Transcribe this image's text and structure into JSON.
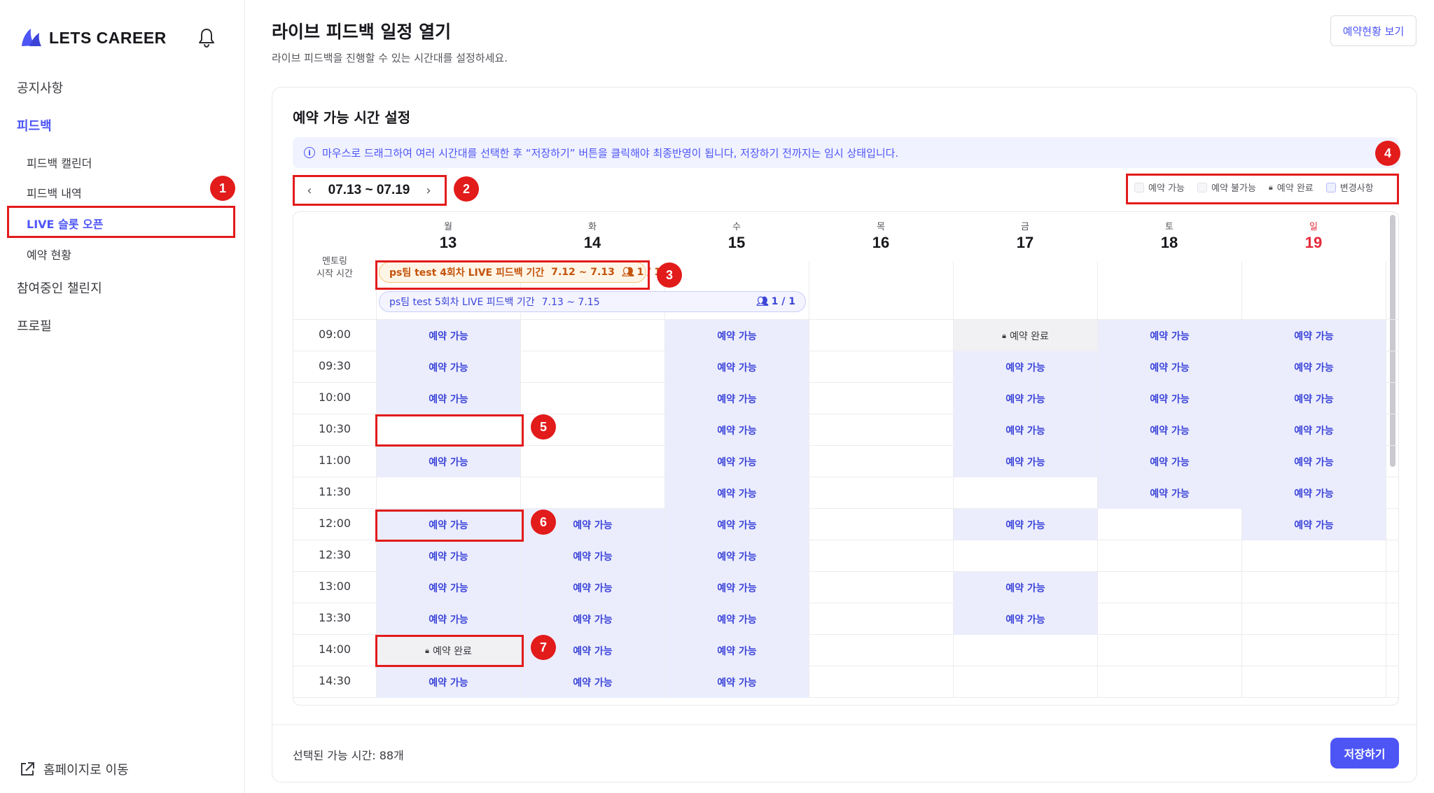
{
  "app": {
    "logo_text": "LETS CAREER"
  },
  "sidebar": {
    "items": [
      {
        "label": "공지사항"
      },
      {
        "label": "피드백"
      },
      {
        "label": "참여중인 챌린지"
      },
      {
        "label": "프로필"
      }
    ],
    "sub_items": [
      {
        "label": "피드백 캘린더"
      },
      {
        "label": "피드백 내역"
      },
      {
        "label": "LIVE 슬롯 오픈"
      },
      {
        "label": "예약 현황"
      }
    ],
    "home_link": "홈페이지로 이동"
  },
  "header": {
    "title": "라이브 피드백 일정 열기",
    "subtitle": "라이브 피드백을 진행할 수 있는 시간대를 설정하세요.",
    "status_button": "예약현황 보기"
  },
  "card": {
    "title": "예약 가능 시간 설정",
    "notice": "마우스로 드래그하여 여러 시간대를 선택한 후 “저장하기” 버튼을 클릭해야 최종반영이 됩니다, 저장하기 전까지는 임시 상태입니다."
  },
  "week": {
    "prev": "‹",
    "range": "07.13 ~ 07.19",
    "next": "›"
  },
  "legend": [
    {
      "label": "예약 가능"
    },
    {
      "label": "예약 불가능"
    },
    {
      "label": "예약 완료"
    },
    {
      "label": "변경사항"
    }
  ],
  "calendar": {
    "mentor_label_1": "멘토링",
    "mentor_label_2": "시작 시간",
    "days": [
      {
        "dow": "월",
        "date": "13"
      },
      {
        "dow": "화",
        "date": "14"
      },
      {
        "dow": "수",
        "date": "15"
      },
      {
        "dow": "목",
        "date": "16"
      },
      {
        "dow": "금",
        "date": "17"
      },
      {
        "dow": "토",
        "date": "18"
      },
      {
        "dow": "일",
        "date": "19"
      }
    ],
    "periods": [
      {
        "name": "ps팀 test 4회차 LIVE 피드백 기간",
        "dates": "7.12 ~ 7.13",
        "count": "1 / 1"
      },
      {
        "name": "ps팀 test 5회차 LIVE 피드백 기간",
        "dates": "7.13 ~ 7.15",
        "count": "1 / 1"
      }
    ],
    "slot_labels": {
      "A": "예약 가능",
      "B": "예약 완료"
    },
    "times": [
      "09:00",
      "09:30",
      "10:00",
      "10:30",
      "11:00",
      "11:30",
      "12:00",
      "12:30",
      "13:00",
      "13:30",
      "14:00",
      "14:30"
    ],
    "grid": [
      [
        "A",
        "",
        "A",
        "",
        "B",
        "A",
        "A"
      ],
      [
        "A",
        "",
        "A",
        "",
        "A",
        "A",
        "A"
      ],
      [
        "A",
        "",
        "A",
        "",
        "A",
        "A",
        "A"
      ],
      [
        "",
        "",
        "A",
        "",
        "A",
        "A",
        "A"
      ],
      [
        "A",
        "",
        "A",
        "",
        "A",
        "A",
        "A"
      ],
      [
        "",
        "",
        "A",
        "",
        "",
        "A",
        "A"
      ],
      [
        "A",
        "A",
        "A",
        "",
        "A",
        "",
        "A"
      ],
      [
        "A",
        "A",
        "A",
        "",
        "",
        "",
        ""
      ],
      [
        "A",
        "A",
        "A",
        "",
        "A",
        "",
        ""
      ],
      [
        "A",
        "A",
        "A",
        "",
        "A",
        "",
        ""
      ],
      [
        "B",
        "A",
        "A",
        "",
        "",
        "",
        ""
      ],
      [
        "A",
        "A",
        "A",
        "",
        "",
        "",
        ""
      ]
    ]
  },
  "footer": {
    "selected_count": "선택된 가능 시간: 88개",
    "save_button": "저장하기"
  },
  "annotations": [
    "1",
    "2",
    "3",
    "4",
    "5",
    "6",
    "7"
  ],
  "colors": {
    "accent": "#4d55f5",
    "available_bg": "#ebedfd",
    "booked_bg": "#f1f1f3",
    "annotation_red": "#e21b1b",
    "sunday_red": "#e5283a"
  }
}
